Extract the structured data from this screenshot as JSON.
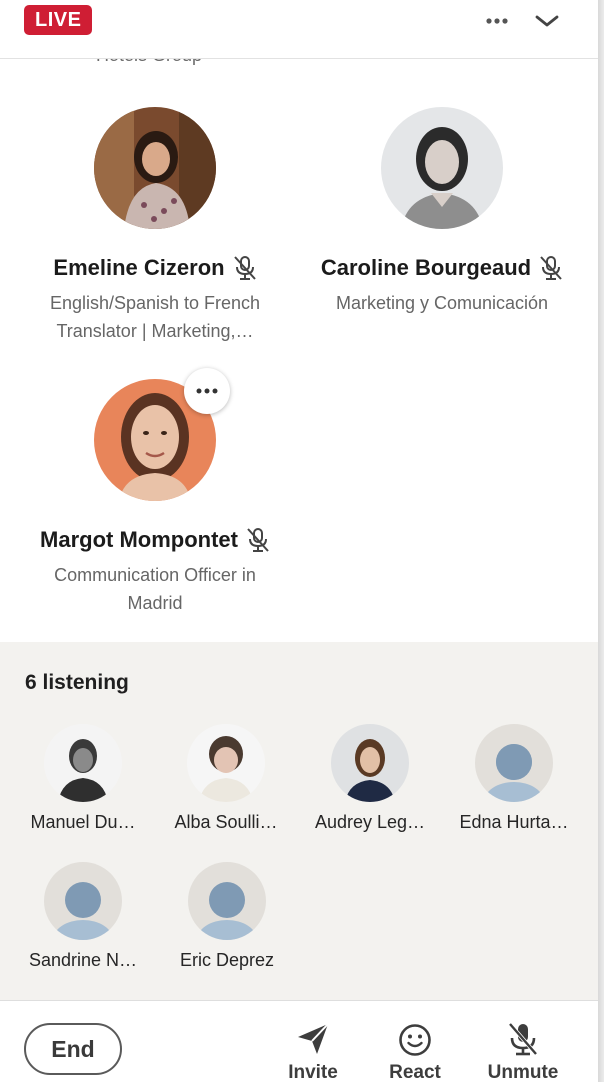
{
  "header": {
    "live_badge": "LIVE",
    "truncated_text": "Hotels Group"
  },
  "speakers": [
    {
      "name": "Emeline Cizeron",
      "headline": "English/Spanish to French Translator | Marketing,…",
      "muted": true
    },
    {
      "name": "Caroline Bourgeaud",
      "headline": "Marketing y Comunicación",
      "muted": true
    },
    {
      "name": "Margot Mompontet",
      "headline": "Communication Officer in Madrid",
      "muted": true
    }
  ],
  "listeners": {
    "title": "6 listening",
    "people": [
      {
        "name": "Manuel Du…"
      },
      {
        "name": "Alba Soulli…"
      },
      {
        "name": "Audrey Leg…"
      },
      {
        "name": "Edna Hurta…"
      },
      {
        "name": "Sandrine N…"
      },
      {
        "name": "Eric Deprez"
      }
    ]
  },
  "footer": {
    "end_label": "End",
    "invite_label": "Invite",
    "react_label": "React",
    "unmute_label": "Unmute"
  },
  "icons": [
    "more-horizontal-icon",
    "chevron-down-icon",
    "mic-off-icon",
    "send-icon",
    "smiley-icon"
  ],
  "colors": {
    "live": "#cf1e34",
    "listeners_bg": "#f3f2ef",
    "placeholder_avatar": "#e2dfda"
  }
}
